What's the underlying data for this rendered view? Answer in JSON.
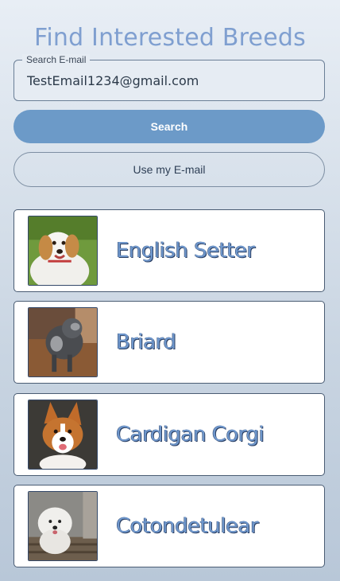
{
  "title": "Find Interested Breeds",
  "search": {
    "label": "Search E-mail",
    "value": "TestEmail1234@gmail.com"
  },
  "buttons": {
    "search": "Search",
    "use_email": "Use my E-mail"
  },
  "breeds": [
    {
      "name": "English Setter",
      "photo": "english-setter-photo"
    },
    {
      "name": "Briard",
      "photo": "briard-photo"
    },
    {
      "name": "Cardigan Corgi",
      "photo": "cardigan-corgi-photo"
    },
    {
      "name": "Cotondetulear",
      "photo": "cotondetulear-photo"
    }
  ],
  "colors": {
    "accent": "#6c9ac8",
    "title": "#7f9fd0"
  }
}
